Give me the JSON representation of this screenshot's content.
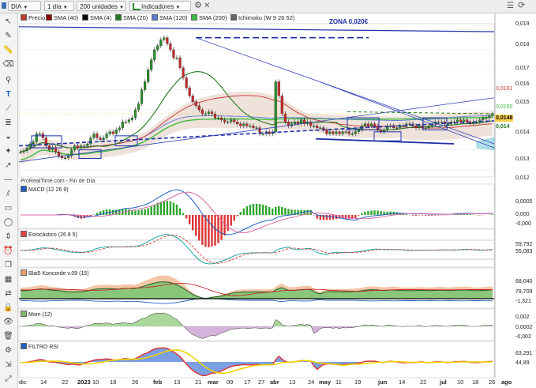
{
  "toolbar": {
    "instrument": "DIA",
    "timeframe": "1 día",
    "units": "200 unidades",
    "indicators": "Indicadores"
  },
  "main_legend": [
    {
      "label": "Precio",
      "color": "#c0392b"
    },
    {
      "label": "SMA (40)",
      "color": "#8b0000"
    },
    {
      "label": "SMA (4)",
      "color": "#000000"
    },
    {
      "label": "SMA (20)",
      "color": "#1f7a1f"
    },
    {
      "label": "SMA (120)",
      "color": "#5b7bd5"
    },
    {
      "label": "SMA (200)",
      "color": "#3dbb3d"
    },
    {
      "label": "Ichimoku (W 9 26 52)",
      "color": "#666666"
    }
  ],
  "annotation": "ZONA 0,020€",
  "source": "ProRealTime.com - Fin de Día",
  "panels": {
    "macd": "MACD (12 26 9)",
    "stoch": "Estocástico (26 8 5)",
    "koncorde": "Blai5 Koncorde v.09 (15)",
    "mom": "Mom (12)",
    "rsi": "FILTRO RSI"
  },
  "right_axis": {
    "main": [
      "0,019",
      "0,018",
      "0,017",
      "0,016",
      "0,015",
      "0,014",
      "0,013",
      "0,012"
    ],
    "main_tags": [
      {
        "text": "0,0161",
        "color": "#cc3333",
        "bg": "#ffffff"
      },
      {
        "text": "0,0150",
        "color": "#3dbb3d",
        "bg": "#ffffff"
      },
      {
        "text": "0,0148",
        "color": "#000000",
        "bg": "#ffd24d"
      },
      {
        "text": "0,014",
        "color": "#1f7a1f",
        "bg": "#ffffff"
      }
    ],
    "macd": [
      "0,0005",
      "0,000",
      "-0,000"
    ],
    "stoch": [
      "59,792",
      "55,083"
    ],
    "koncorde": [
      "68,040",
      "78,709",
      "-1,321"
    ],
    "mom": [
      "0,002",
      "0,0002",
      "-0,002"
    ],
    "rsi": [
      "63,291",
      "44,89"
    ]
  },
  "x_labels": [
    "dic",
    "14",
    "22",
    "2023",
    "10",
    "18",
    "26",
    "feb",
    "13",
    "21",
    "mar",
    "09",
    "17",
    "27",
    "abr",
    "13",
    "24",
    "may",
    "11",
    "19",
    "jun",
    "14",
    "22",
    "jul",
    "10",
    "18",
    "26",
    "ago"
  ],
  "chart_data": {
    "type": "candlestick",
    "x_range": [
      "dic 2022",
      "ago 2023"
    ],
    "ylim": [
      0.0118,
      0.0193
    ],
    "ichimoku_cloud": true,
    "close": [
      0.0129,
      0.01295,
      0.0131,
      0.0133,
      0.0134,
      0.0138,
      0.0138,
      0.0136,
      0.0132,
      0.013,
      0.0131,
      0.0129,
      0.0127,
      0.0126,
      0.0126,
      0.0127,
      0.013,
      0.0132,
      0.0131,
      0.0132,
      0.0132,
      0.0133,
      0.0136,
      0.0138,
      0.0136,
      0.0135,
      0.0136,
      0.0138,
      0.0139,
      0.0138,
      0.014,
      0.0141,
      0.0144,
      0.0144,
      0.0145,
      0.0146,
      0.015,
      0.0153,
      0.016,
      0.0164,
      0.017,
      0.0175,
      0.018,
      0.0182,
      0.0185,
      0.0186,
      0.0183,
      0.018,
      0.0176,
      0.0176,
      0.0171,
      0.0166,
      0.0161,
      0.0157,
      0.0154,
      0.0152,
      0.015,
      0.0148,
      0.0148,
      0.0149,
      0.0148,
      0.0146,
      0.0146,
      0.0145,
      0.0144,
      0.0144,
      0.0145,
      0.0144,
      0.0143,
      0.0142,
      0.0143,
      0.0142,
      0.0142,
      0.0141,
      0.0141,
      0.0138,
      0.0138,
      0.0139,
      0.0138,
      0.0139,
      0.0164,
      0.0157,
      0.0148,
      0.0144,
      0.0142,
      0.0143,
      0.0144,
      0.0143,
      0.0145,
      0.0143,
      0.0144,
      0.0142,
      0.0142,
      0.0141,
      0.0141,
      0.014,
      0.0138,
      0.0139,
      0.0138,
      0.0139,
      0.0138,
      0.0139,
      0.0139,
      0.0138,
      0.0138,
      0.0139,
      0.014,
      0.0142,
      0.0143,
      0.0142,
      0.0143,
      0.0142,
      0.014,
      0.0139,
      0.014,
      0.0142,
      0.0142,
      0.0141,
      0.0141,
      0.0142,
      0.0142,
      0.0143,
      0.0143,
      0.0142,
      0.0141,
      0.0142,
      0.0141,
      0.0141,
      0.0142,
      0.0143,
      0.0144,
      0.0144,
      0.0144,
      0.0143,
      0.0143,
      0.0144,
      0.0144,
      0.0145,
      0.0144,
      0.0145,
      0.0144,
      0.0143,
      0.0144,
      0.0144,
      0.0145,
      0.0146,
      0.0146,
      0.0147,
      0.0148
    ],
    "last_price": 0.0148
  }
}
